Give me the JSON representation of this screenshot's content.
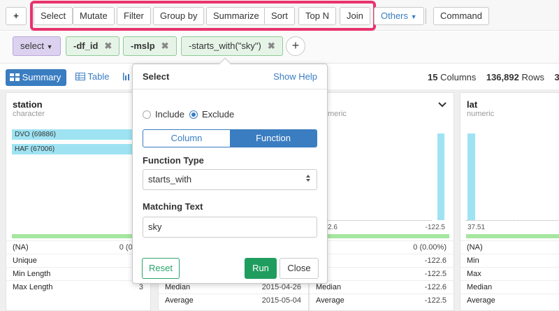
{
  "toolbar": {
    "add": "+",
    "buttons": [
      "Select",
      "Mutate",
      "Filter",
      "Group by",
      "Summarize",
      "Sort",
      "Top N",
      "Join"
    ],
    "others": "Others",
    "command": "Command"
  },
  "steps": {
    "select": "select",
    "chips": [
      "-df_id",
      "-mslp",
      "-starts_with(\"sky\")"
    ],
    "remove": "✖",
    "add": "+"
  },
  "view": {
    "summary": "Summary",
    "table": "Table",
    "columns_count": "15",
    "columns_label": "Columns",
    "rows_count": "136,892",
    "rows_label": "Rows",
    "trailing": "3"
  },
  "columns": {
    "station": {
      "name": "station",
      "type": "character",
      "bars": [
        "DVO (69886)",
        "HAF (67006)"
      ],
      "stats": [
        {
          "k": "(NA)",
          "v": "0 (0.00"
        },
        {
          "k": "Unique",
          "v": ""
        },
        {
          "k": "Min Length",
          "v": ""
        },
        {
          "k": "Max Length",
          "v": "3"
        }
      ]
    },
    "date_partial": {
      "stats": [
        {
          "k": "Median",
          "v": "2015-04-26"
        },
        {
          "k": "Average",
          "v": "2015-05-04"
        }
      ]
    },
    "numeric_col": {
      "type": "meric",
      "axis_min": "2.6",
      "axis_max": "-122.5",
      "stats": [
        {
          "k": ")",
          "v": "0 (0.00%)"
        },
        {
          "k": "",
          "v": "-122.6"
        },
        {
          "k": "x",
          "v": "-122.5"
        },
        {
          "k": "Median",
          "v": "-122.6"
        },
        {
          "k": "Average",
          "v": "-122.5"
        }
      ]
    },
    "lat": {
      "name": "lat",
      "type": "numeric",
      "axis_min": "37.51",
      "stats": [
        {
          "k": "(NA)",
          "v": ""
        },
        {
          "k": "Min",
          "v": ""
        },
        {
          "k": "Max",
          "v": ""
        },
        {
          "k": "Median",
          "v": ""
        },
        {
          "k": "Average",
          "v": ""
        }
      ]
    }
  },
  "popup": {
    "title": "Select",
    "help": "Show Help",
    "include": "Include",
    "exclude": "Exclude",
    "seg_column": "Column",
    "seg_function": "Function",
    "function_type_label": "Function Type",
    "function_type_value": "starts_with",
    "matching_label": "Matching Text",
    "matching_value": "sky",
    "reset": "Reset",
    "run": "Run",
    "close": "Close"
  },
  "colors": {
    "accent": "#3a7dc1",
    "highlight": "#e8336d",
    "run": "#1f9d5f",
    "bar": "#9fe3f3",
    "na_bar": "#a6e6a0"
  }
}
